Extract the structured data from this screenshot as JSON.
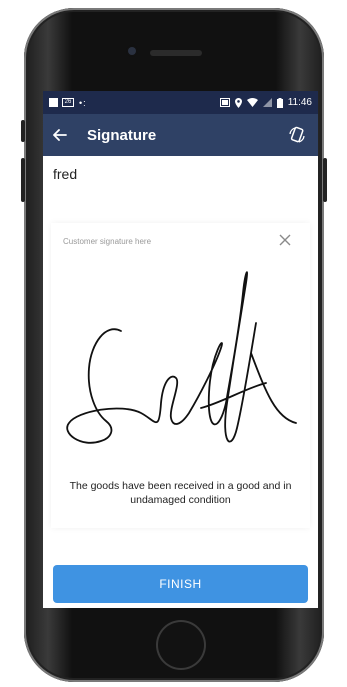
{
  "status_bar": {
    "left_icon_label": "26",
    "notif_dots": "•:",
    "time": "11:46"
  },
  "app_bar": {
    "back_icon": "arrow-left-icon",
    "title": "Signature",
    "rotate_icon": "rotate-screen-icon"
  },
  "customer": {
    "name": "fred"
  },
  "signature_panel": {
    "hint": "Customer signature here",
    "clear_icon": "close-icon",
    "confirmation_text": "The goods have been received in a good and in undamaged condition"
  },
  "actions": {
    "finish_label": "FINISH"
  },
  "colors": {
    "status_bar": "#1e2a4c",
    "app_bar": "#2f4165",
    "finish_button": "#3f93e2"
  }
}
